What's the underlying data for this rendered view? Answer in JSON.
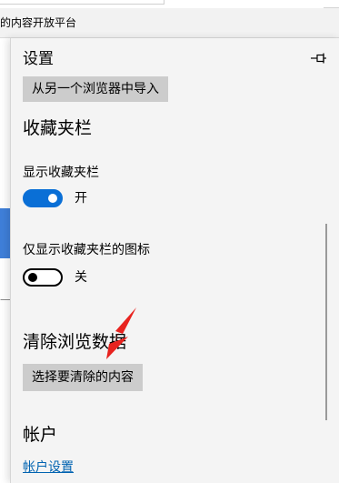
{
  "background": {
    "favorites_bar_item": "的内容开放平台",
    "side_text": "一按"
  },
  "panel": {
    "title": "设置",
    "pin_icon": "pin-icon",
    "import_button_label": "从另一个浏览器中导入",
    "favorites_bar": {
      "heading": "收藏夹栏",
      "show_favorites_bar": {
        "label": "显示收藏夹栏",
        "state_label": "开",
        "value": true
      },
      "show_only_icons": {
        "label": "仅显示收藏夹栏的图标",
        "state_label": "关",
        "value": false
      }
    },
    "clear_browsing_data": {
      "heading": "清除浏览数据",
      "button_label": "选择要清除的内容"
    },
    "account": {
      "heading": "帐户",
      "link_label": "帐户设置"
    }
  },
  "colors": {
    "accent": "#0a6fd6",
    "panel_background": "#f4f4f4",
    "button_background": "#cccccc",
    "link": "#0063b1",
    "annotation_arrow": "#e8231f"
  }
}
